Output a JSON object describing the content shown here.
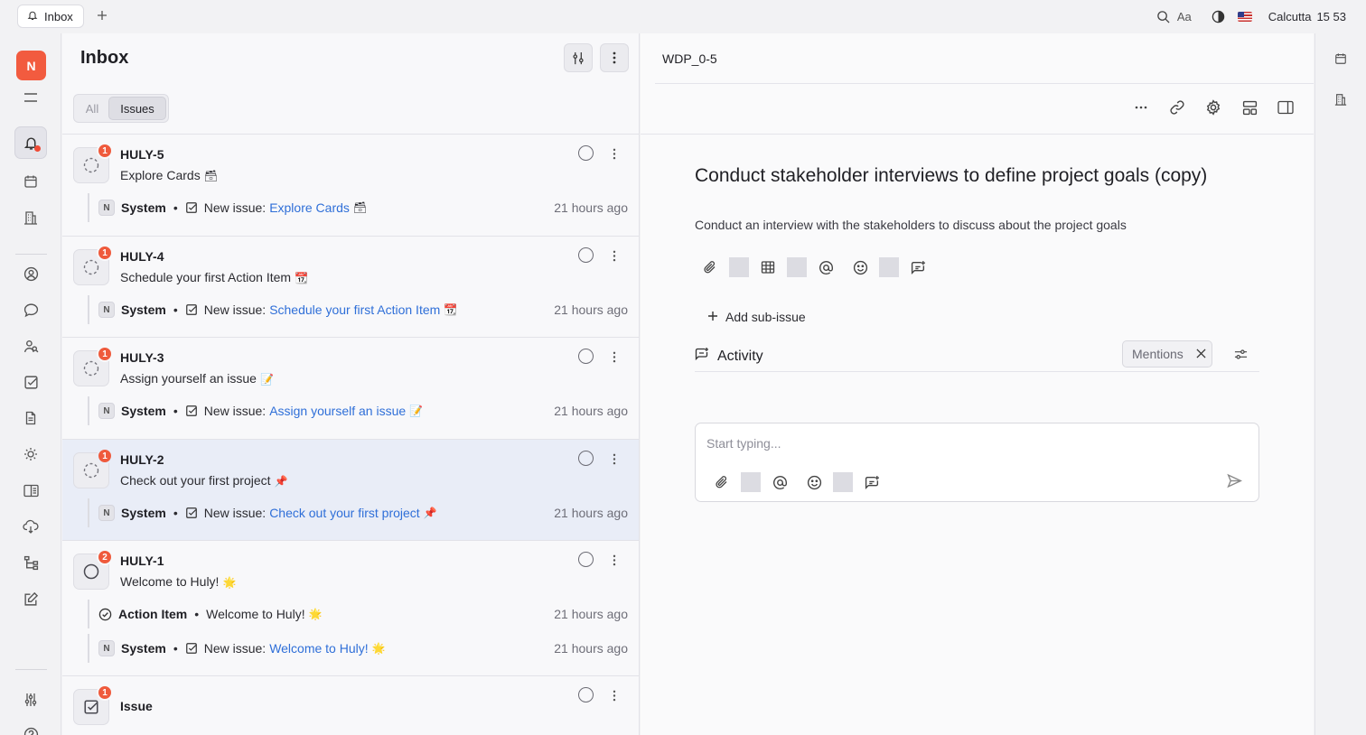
{
  "topbar": {
    "tab_label": "Inbox",
    "text_size_label": "Aa",
    "location": "Calcutta",
    "time": "15 53"
  },
  "rail": {
    "workspace_initial": "N"
  },
  "inbox": {
    "title": "Inbox",
    "filters": {
      "all": "All",
      "issues": "Issues"
    },
    "cards": [
      {
        "id": "HULY-5",
        "title": "Explore Cards",
        "title_emoji": "🗃",
        "badge": "1",
        "selected": false,
        "rows": [
          {
            "avatar": "N",
            "who": "System",
            "action": "New issue:",
            "link": "Explore Cards",
            "emoji": "🗃",
            "time": "21 hours ago"
          }
        ]
      },
      {
        "id": "HULY-4",
        "title": "Schedule your first Action Item",
        "title_emoji": "📆",
        "badge": "1",
        "selected": false,
        "rows": [
          {
            "avatar": "N",
            "who": "System",
            "action": "New issue:",
            "link": "Schedule your first Action Item",
            "emoji": "📆",
            "time": "21 hours ago"
          }
        ]
      },
      {
        "id": "HULY-3",
        "title": "Assign yourself an issue",
        "title_emoji": "📝",
        "badge": "1",
        "selected": false,
        "rows": [
          {
            "avatar": "N",
            "who": "System",
            "action": "New issue:",
            "link": "Assign yourself an issue",
            "emoji": "📝",
            "time": "21 hours ago"
          }
        ]
      },
      {
        "id": "HULY-2",
        "title": "Check out your first project",
        "title_emoji": "📌",
        "badge": "1",
        "selected": true,
        "rows": [
          {
            "avatar": "N",
            "who": "System",
            "action": "New issue:",
            "link": "Check out your first project",
            "emoji": "📌",
            "time": "21 hours ago"
          }
        ]
      },
      {
        "id": "HULY-1",
        "title": "Welcome to Huly!",
        "title_emoji": "🌟",
        "badge": "2",
        "selected": false,
        "rows": [
          {
            "who": "Action Item",
            "text": "Welcome to Huly!",
            "emoji": "🌟",
            "time": "21 hours ago"
          },
          {
            "avatar": "N",
            "who": "System",
            "action": "New issue:",
            "link": "Welcome to Huly!",
            "emoji": "🌟",
            "time": "21 hours ago"
          }
        ]
      },
      {
        "id": "Issue",
        "badge": "1",
        "selected": false,
        "rows": []
      }
    ]
  },
  "detail": {
    "id": "WDP_0-5",
    "title": "Conduct stakeholder interviews to define project goals (copy)",
    "description": "Conduct an interview with the stakeholders to discuss about the project goals",
    "add_sub_issue": "Add sub-issue",
    "activity_label": "Activity",
    "mentions_label": "Mentions",
    "composer_placeholder": "Start typing..."
  },
  "colors": {
    "accent_red": "#f25b3f",
    "link_blue": "#2f6fd8",
    "selected_bg": "#e9edf7"
  }
}
